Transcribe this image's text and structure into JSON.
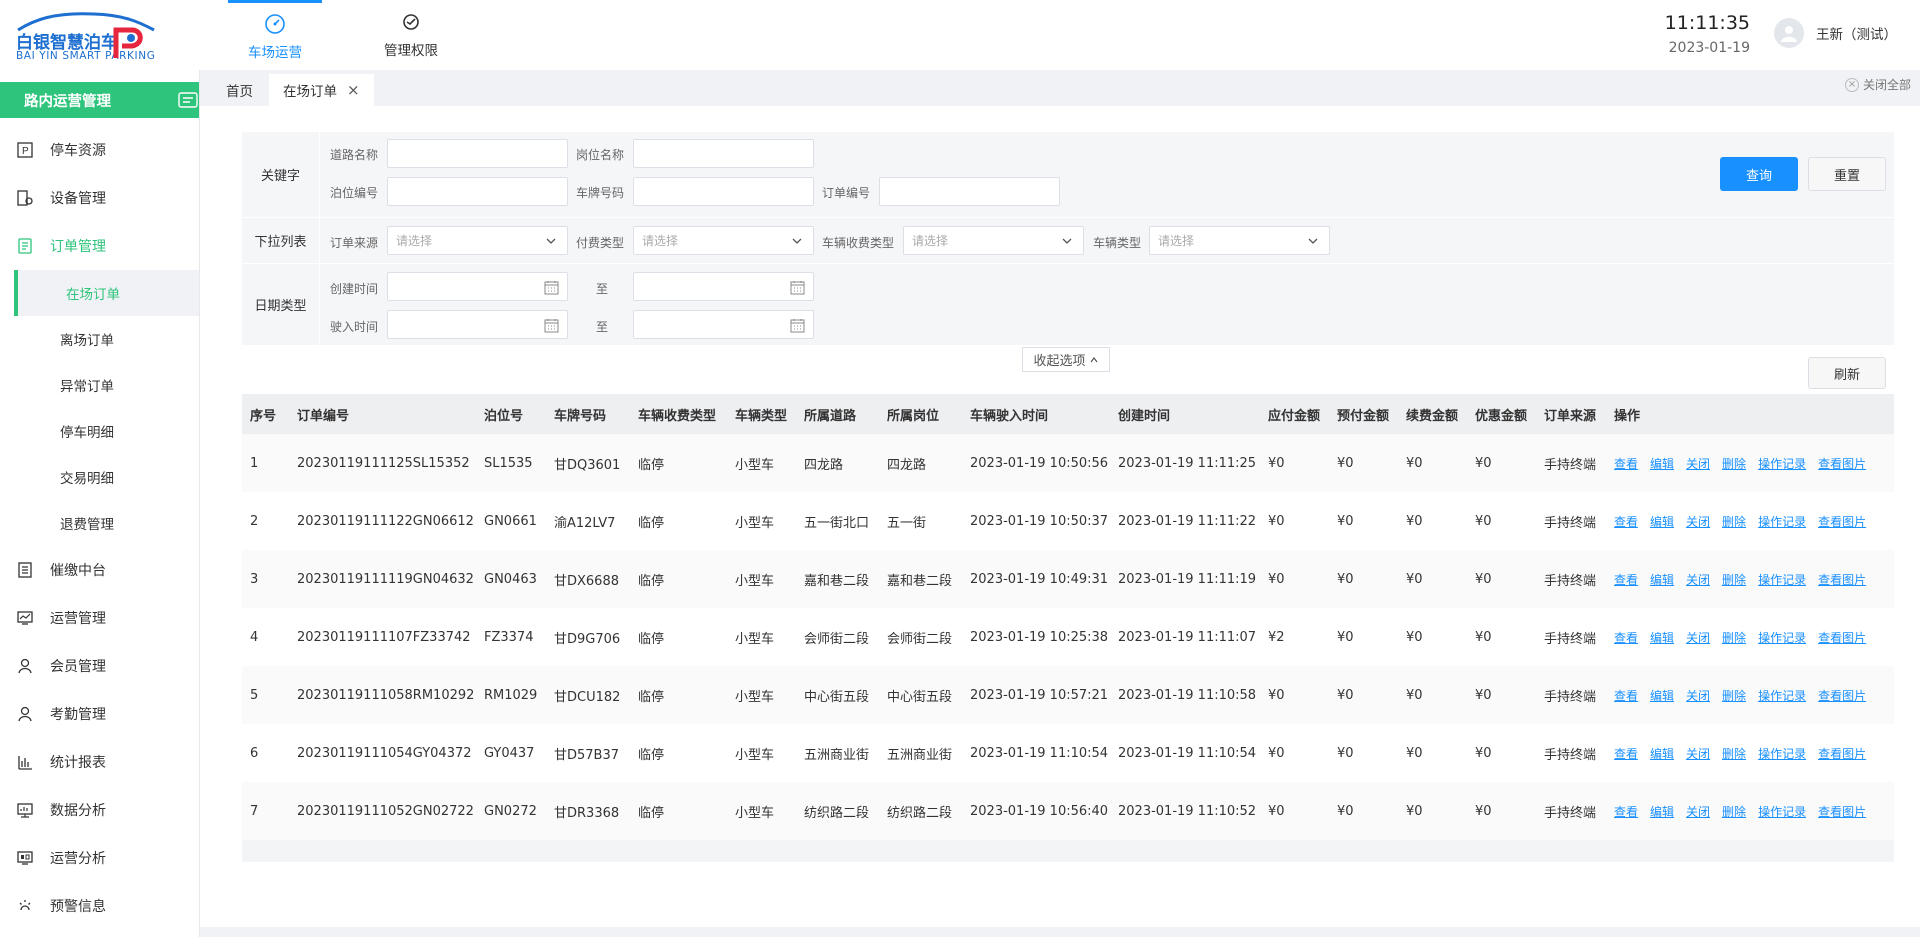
{
  "app": {
    "logo_cn": "白银智慧泊车",
    "logo_en": "BAI YIN SMART PARKING"
  },
  "topnav": [
    {
      "label": "车场运营",
      "icon": "speedometer-icon",
      "active": true
    },
    {
      "label": "管理权限",
      "icon": "shield-gear-icon",
      "active": false
    }
  ],
  "clock": {
    "time": "11:11:35",
    "date": "2023-01-19"
  },
  "user": {
    "name": "王新（测试）"
  },
  "sidebar": {
    "header": "路内运营管理",
    "items": [
      {
        "label": "停车资源",
        "icon": "parking-icon"
      },
      {
        "label": "设备管理",
        "icon": "device-icon"
      },
      {
        "label": "订单管理",
        "icon": "order-icon",
        "open": true
      },
      {
        "label": "催缴中台",
        "icon": "document-icon"
      },
      {
        "label": "运营管理",
        "icon": "chart-line-icon"
      },
      {
        "label": "会员管理",
        "icon": "user-icon"
      },
      {
        "label": "考勤管理",
        "icon": "user-icon"
      },
      {
        "label": "统计报表",
        "icon": "bar-chart-icon"
      },
      {
        "label": "数据分析",
        "icon": "monitor-icon"
      },
      {
        "label": "运营分析",
        "icon": "monitor-data-icon"
      },
      {
        "label": "预警信息",
        "icon": "alert-icon"
      }
    ],
    "subitems": [
      "在场订单",
      "离场订单",
      "异常订单",
      "停车明细",
      "交易明细",
      "退费管理"
    ]
  },
  "tabs": [
    {
      "label": "首页"
    },
    {
      "label": "在场订单",
      "active": true
    }
  ],
  "close_all": "关闭全部",
  "filter": {
    "keyword_header": "关键字",
    "dropdown_header": "下拉列表",
    "date_header": "日期类型",
    "road_name": "道路名称",
    "post_name": "岗位名称",
    "berth_no": "泊位编号",
    "plate_no": "车牌号码",
    "order_no": "订单编号",
    "order_source": "订单来源",
    "pay_type": "付费类型",
    "fee_type": "车辆收费类型",
    "vehicle_type": "车辆类型",
    "placeholder": "请选择",
    "create_time": "创建时间",
    "enter_time": "驶入时间",
    "to": "至",
    "search": "查询",
    "reset": "重置",
    "collapse": "收起选项",
    "refresh": "刷新"
  },
  "table": {
    "headers": [
      "序号",
      "订单编号",
      "泊位号",
      "车牌号码",
      "车辆收费类型",
      "车辆类型",
      "所属道路",
      "所属岗位",
      "车辆驶入时间",
      "创建时间",
      "应付金额",
      "预付金额",
      "续费金额",
      "优惠金额",
      "订单来源",
      "操作"
    ],
    "actions": [
      "查看",
      "编辑",
      "关闭",
      "删除",
      "操作记录",
      "查看图片"
    ],
    "rows": [
      [
        "1",
        "20230119111125SL15352",
        "SL1535",
        "甘DQ3601",
        "临停",
        "小型车",
        "四龙路",
        "四龙路",
        "2023-01-19 10:50:56",
        "2023-01-19 11:11:25",
        "¥0",
        "¥0",
        "¥0",
        "¥0",
        "手持终端"
      ],
      [
        "2",
        "20230119111122GN06612",
        "GN0661",
        "渝A12LV7",
        "临停",
        "小型车",
        "五一街北口",
        "五一街",
        "2023-01-19 10:50:37",
        "2023-01-19 11:11:22",
        "¥0",
        "¥0",
        "¥0",
        "¥0",
        "手持终端"
      ],
      [
        "3",
        "20230119111119GN04632",
        "GN0463",
        "甘DX6688",
        "临停",
        "小型车",
        "嘉和巷二段",
        "嘉和巷二段",
        "2023-01-19 10:49:31",
        "2023-01-19 11:11:19",
        "¥0",
        "¥0",
        "¥0",
        "¥0",
        "手持终端"
      ],
      [
        "4",
        "20230119111107FZ33742",
        "FZ3374",
        "甘D9G706",
        "临停",
        "小型车",
        "会师街二段",
        "会师街二段",
        "2023-01-19 10:25:38",
        "2023-01-19 11:11:07",
        "¥2",
        "¥0",
        "¥0",
        "¥0",
        "手持终端"
      ],
      [
        "5",
        "20230119111058RM10292",
        "RM1029",
        "甘DCU182",
        "临停",
        "小型车",
        "中心街五段",
        "中心街五段",
        "2023-01-19 10:57:21",
        "2023-01-19 11:10:58",
        "¥0",
        "¥0",
        "¥0",
        "¥0",
        "手持终端"
      ],
      [
        "6",
        "20230119111054GY04372",
        "GY0437",
        "甘D57B37",
        "临停",
        "小型车",
        "五洲商业街",
        "五洲商业街",
        "2023-01-19 11:10:54",
        "2023-01-19 11:10:54",
        "¥0",
        "¥0",
        "¥0",
        "¥0",
        "手持终端"
      ],
      [
        "7",
        "20230119111052GN02722",
        "GN0272",
        "甘DR3368",
        "临停",
        "小型车",
        "纺织路二段",
        "纺织路二段",
        "2023-01-19 10:56:40",
        "2023-01-19 11:10:52",
        "¥0",
        "¥0",
        "¥0",
        "¥0",
        "手持终端"
      ]
    ]
  },
  "colors": {
    "accent": "#1890ff",
    "brand_green": "#2ec47c"
  }
}
